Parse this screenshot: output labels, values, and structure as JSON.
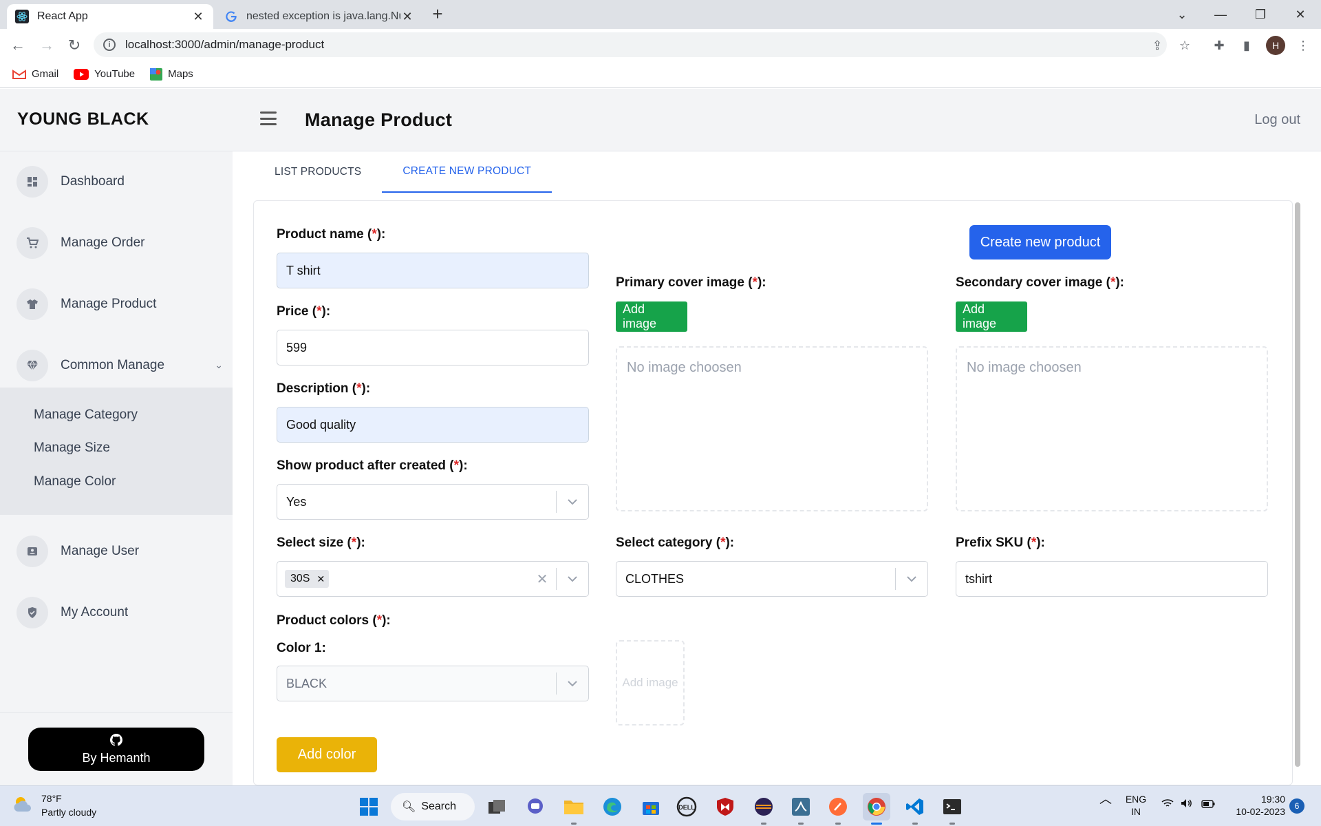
{
  "browser": {
    "tabs": [
      {
        "title": "React App",
        "icon": "react-icon"
      },
      {
        "title": "nested exception is java.lang.Null",
        "icon": "google-icon"
      }
    ],
    "url": "localhost:3000/admin/manage-product",
    "bookmarks": [
      {
        "label": "Gmail",
        "icon": "gmail-icon"
      },
      {
        "label": "YouTube",
        "icon": "youtube-icon"
      },
      {
        "label": "Maps",
        "icon": "maps-icon"
      }
    ],
    "profile_initial": "H"
  },
  "app": {
    "brand": "YOUNG BLACK",
    "page_title": "Manage Product",
    "logout": "Log out",
    "nav": {
      "dashboard": "Dashboard",
      "manage_order": "Manage Order",
      "manage_product": "Manage Product",
      "common_manage": "Common Manage",
      "manage_category": "Manage Category",
      "manage_size": "Manage Size",
      "manage_color": "Manage Color",
      "manage_user": "Manage User",
      "my_account": "My Account"
    },
    "credit": "By Hemanth",
    "tabs": {
      "list": "LIST PRODUCTS",
      "create": "CREATE NEW PRODUCT"
    },
    "form": {
      "required_mark": "*",
      "product_name_label": "Product name",
      "product_name_value": "T shirt",
      "price_label": "Price",
      "price_value": "599",
      "description_label": "Description",
      "description_value": "Good quality",
      "show_label": "Show product after created",
      "show_value": "Yes",
      "size_label": "Select size",
      "size_chip": "30S",
      "colors_label": "Product colors",
      "color1_label": "Color 1:",
      "color1_value": "BLACK",
      "add_color": "Add color",
      "create_button": "Create new product",
      "primary_label": "Primary cover image",
      "secondary_label": "Secondary cover image",
      "add_image": "Add image",
      "no_image": "No image choosen",
      "category_label": "Select category",
      "category_value": "CLOTHES",
      "sku_label": "Prefix SKU",
      "sku_value": "tshirt",
      "color_image_placeholder": "Add image"
    }
  },
  "taskbar": {
    "weather_temp": "78°F",
    "weather_desc": "Partly cloudy",
    "search": "Search",
    "lang1": "ENG",
    "lang2": "IN",
    "time": "19:30",
    "date": "10-02-2023",
    "notif_count": "6"
  },
  "colors": {
    "primary_blue": "#2563eb",
    "green": "#16a34a",
    "yellow": "#eab308",
    "required_red": "#dc2626"
  }
}
